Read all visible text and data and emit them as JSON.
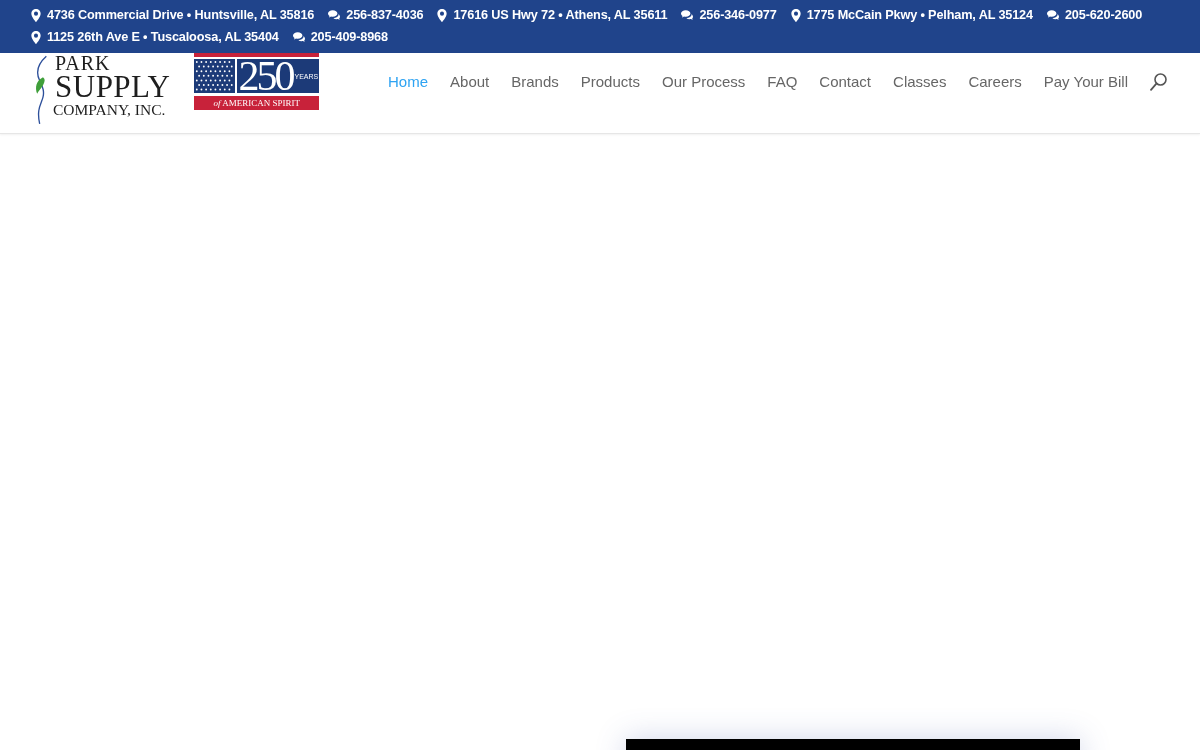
{
  "top_bar": {
    "items": [
      {
        "kind": "address",
        "text": "4736 Commercial Drive • Huntsville, AL 35816"
      },
      {
        "kind": "phone",
        "text": "256-837-4036"
      },
      {
        "kind": "address",
        "text": "17616 US Hwy 72 • Athens, AL 35611"
      },
      {
        "kind": "phone",
        "text": "256-346-0977"
      },
      {
        "kind": "address",
        "text": "1775 McCain Pkwy • Pelham, AL 35124"
      },
      {
        "kind": "phone",
        "text": "205-620-2600"
      },
      {
        "kind": "address",
        "text": "1125 26th Ave E • Tuscaloosa, AL 35404"
      },
      {
        "kind": "phone",
        "text": "205-409-8968"
      }
    ]
  },
  "header": {
    "logo": {
      "lines": [
        "PARK",
        "SUPPLY",
        "COMPANY, INC."
      ]
    },
    "badge": {
      "number": "250",
      "unit": "YEARS",
      "banner": "*of* AMERICAN SPIRIT"
    },
    "nav": [
      {
        "label": "Home",
        "selected": true
      },
      {
        "label": "About",
        "selected": false
      },
      {
        "label": "Brands",
        "selected": false
      },
      {
        "label": "Products",
        "selected": false
      },
      {
        "label": "Our Process",
        "selected": false
      },
      {
        "label": "FAQ",
        "selected": false
      },
      {
        "label": "Contact",
        "selected": false
      },
      {
        "label": "Classes",
        "selected": false
      },
      {
        "label": "Careers",
        "selected": false
      },
      {
        "label": "Pay Your Bill",
        "selected": false
      }
    ]
  }
}
